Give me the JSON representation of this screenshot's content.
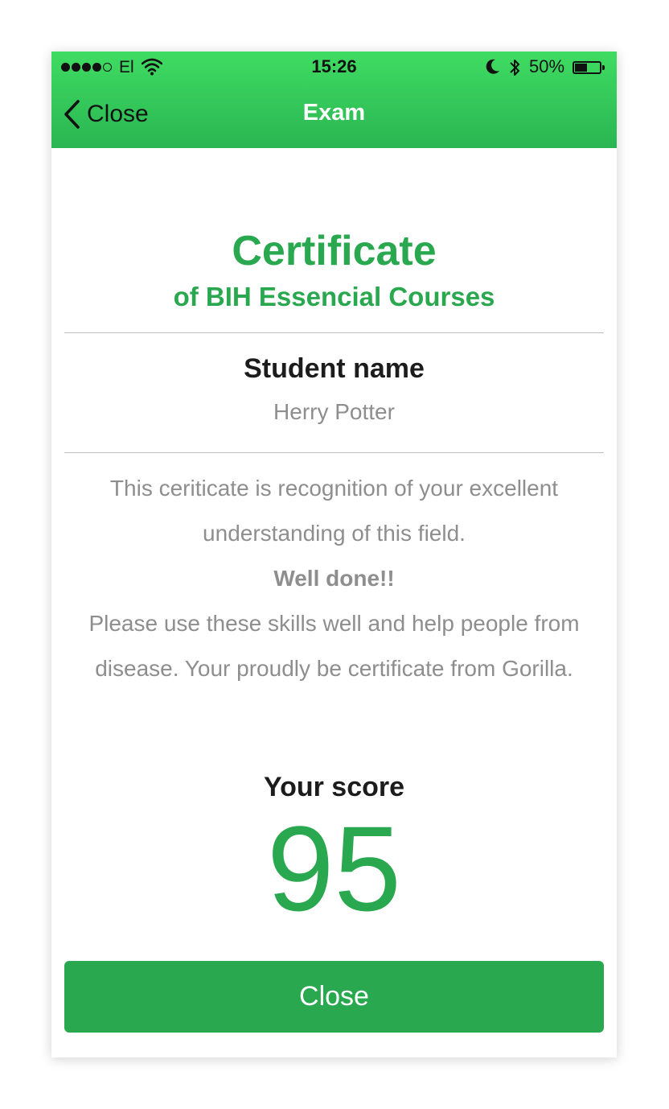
{
  "status_bar": {
    "carrier": "El",
    "time": "15:26",
    "battery_percent": "50%",
    "battery_level": 0.5,
    "signal_bars_filled": 4,
    "signal_bars_total": 5
  },
  "nav": {
    "back_label": "Close",
    "title": "Exam"
  },
  "certificate": {
    "title": "Certificate",
    "subtitle": "of BIH Essencial Courses",
    "student_label": "Student name",
    "student_name": "Herry Potter",
    "message_line_1": "This ceriticate is recognition of your excellent",
    "message_line_2": "understanding of this field.",
    "message_bold": "Well done!!",
    "message_line_3": "Please use these skills well and help people from",
    "message_line_4": "disease. Your proudly be certificate from Gorilla."
  },
  "score": {
    "label": "Your score",
    "value": "95"
  },
  "footer": {
    "close_label": "Close"
  },
  "colors": {
    "accent_green": "#2aa84f",
    "nav_gradient_top": "#3fdc62",
    "nav_gradient_bottom": "#2ab552",
    "muted_text": "#8e8e8e"
  },
  "icons": [
    "back-chevron-icon",
    "wifi-icon",
    "moon-icon",
    "bluetooth-icon",
    "battery-icon"
  ]
}
